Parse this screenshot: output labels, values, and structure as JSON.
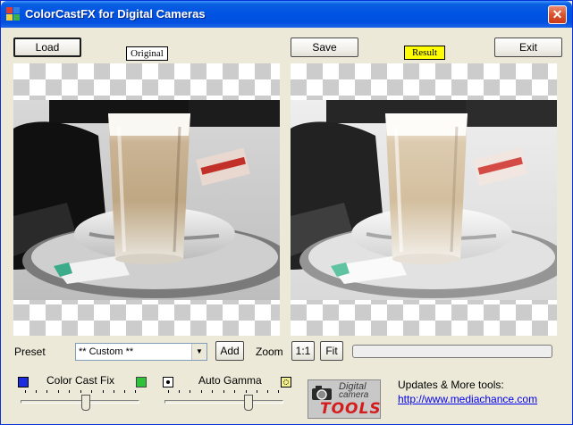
{
  "window": {
    "title": "ColorCastFX for Digital Cameras",
    "close_glyph": "✕"
  },
  "toolbar": {
    "load_label": "Load",
    "save_label": "Save",
    "exit_label": "Exit"
  },
  "panels": {
    "original_label": "Original",
    "result_label": "Result",
    "result_label_color": "#ffff00"
  },
  "controls": {
    "preset_label": "Preset",
    "preset_value": "** Custom **",
    "add_label": "Add",
    "zoom_label": "Zoom",
    "zoom_1to1_label": "1:1",
    "fit_label": "Fit",
    "progress_percent": 0,
    "color_cast_fix_label": "Color Cast Fix",
    "auto_gamma_label": "Auto Gamma",
    "color_cast_fix_level": 0.55,
    "auto_gamma_level": 0.72
  },
  "branding": {
    "logo_line1": "Digital",
    "logo_line2": "camera",
    "logo_line3": "TOOLS",
    "updates_text": "Updates & More tools:",
    "url": "http://www.mediachance.com"
  },
  "colors": {
    "title_bar": "#0054e3",
    "close_button": "#d9532f",
    "link": "#0000ee",
    "swatch_blue": "#1a2ee0",
    "swatch_green": "#2ec43a",
    "logo_red": "#d51c1c"
  },
  "icons": {
    "app": "color-grid-icon",
    "close": "close-icon",
    "dropdown": "chevron-down-icon",
    "color_cast_low": "blue-square-icon",
    "color_cast_high": "green-square-icon",
    "gamma_low": "dark-dot-icon",
    "gamma_high": "light-dot-icon"
  }
}
